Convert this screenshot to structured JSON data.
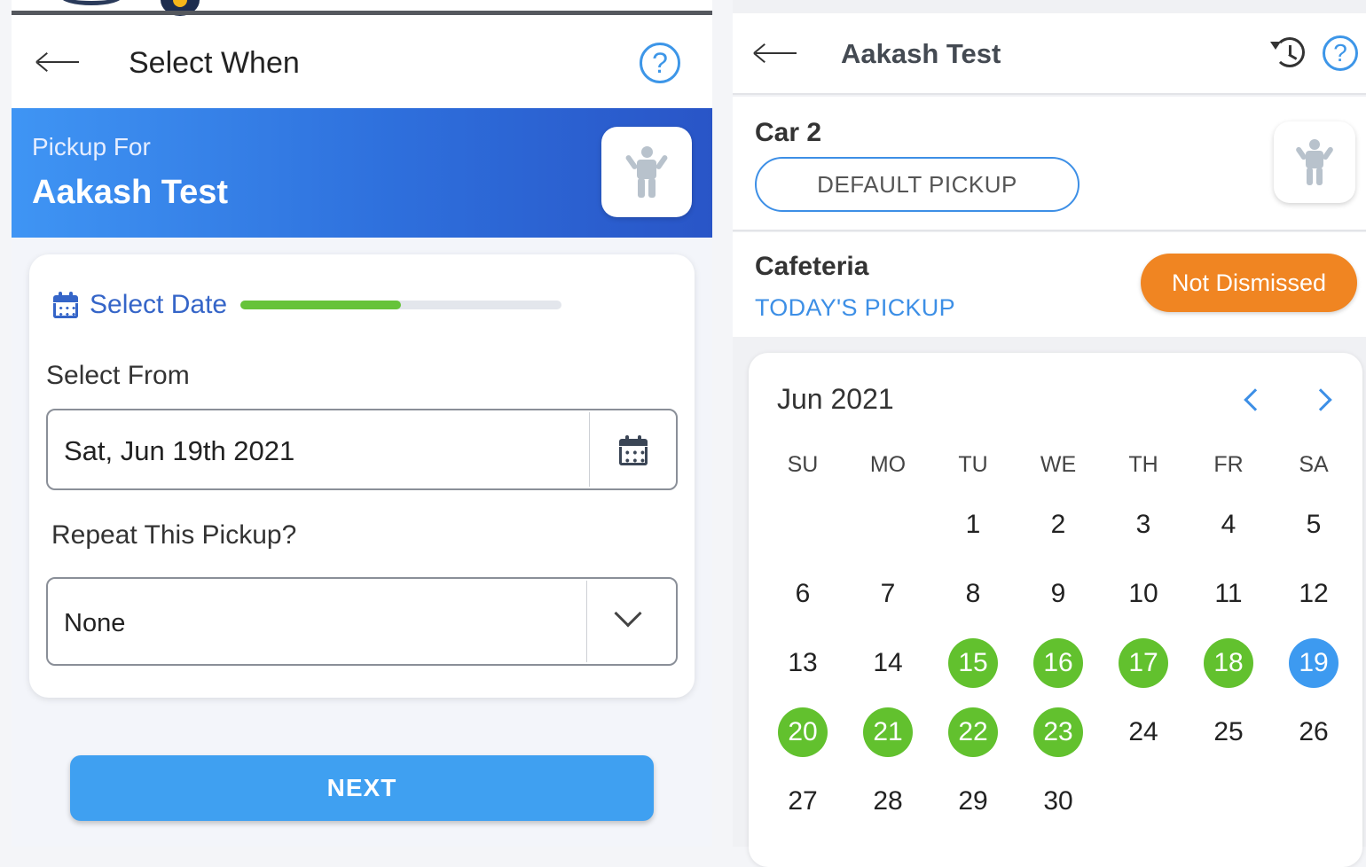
{
  "left": {
    "header": {
      "title": "Select When"
    },
    "banner": {
      "subtitle": "Pickup For",
      "name": "Aakash Test"
    },
    "step": {
      "label": "Select Date",
      "progress": 0.5
    },
    "select_from": {
      "label": "Select From",
      "value": "Sat, Jun 19th 2021"
    },
    "repeat": {
      "label": "Repeat This Pickup?",
      "value": "None"
    },
    "next_label": "NEXT"
  },
  "right": {
    "header": {
      "title": "Aakash Test"
    },
    "car": {
      "label": "Car 2",
      "button": "DEFAULT PICKUP"
    },
    "location": {
      "label": "Cafeteria",
      "sub": "TODAY'S PICKUP",
      "status": "Not Dismissed"
    },
    "calendar": {
      "month": "Jun 2021",
      "weekdays": [
        "SU",
        "MO",
        "TU",
        "WE",
        "TH",
        "FR",
        "SA"
      ],
      "first_weekday": 2,
      "days_in_month": 30,
      "green_days": [
        15,
        16,
        17,
        18,
        20,
        21,
        22,
        23
      ],
      "selected_day": 19
    }
  },
  "colors": {
    "accent": "#3d8fe6",
    "progress": "#66c33a",
    "status": "#f08522",
    "highlight_green": "#62c12e",
    "selected_blue": "#3d9af0"
  }
}
